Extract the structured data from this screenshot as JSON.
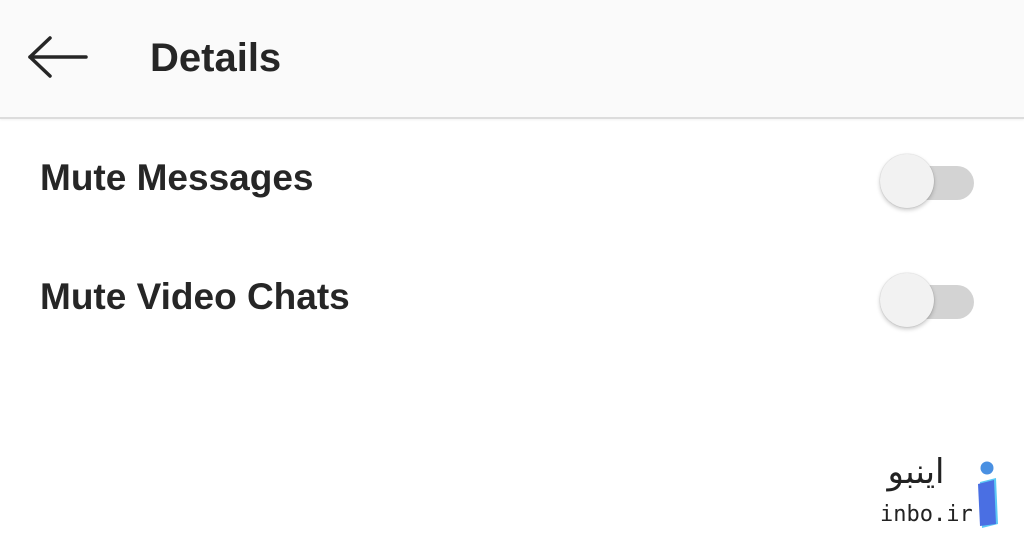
{
  "header": {
    "title": "Details",
    "back_icon": "arrow-left-icon"
  },
  "settings": [
    {
      "label": "Mute Messages",
      "toggle_on": false
    },
    {
      "label": "Mute Video Chats",
      "toggle_on": false
    }
  ],
  "watermark": {
    "text_fa": "اینبو",
    "text_en": "inbo.ir"
  },
  "colors": {
    "header_bg": "#fafafa",
    "text": "#262626",
    "toggle_track": "#d3d3d3",
    "toggle_thumb": "#f2f2f2",
    "logo_accent": "#4a90e2"
  }
}
